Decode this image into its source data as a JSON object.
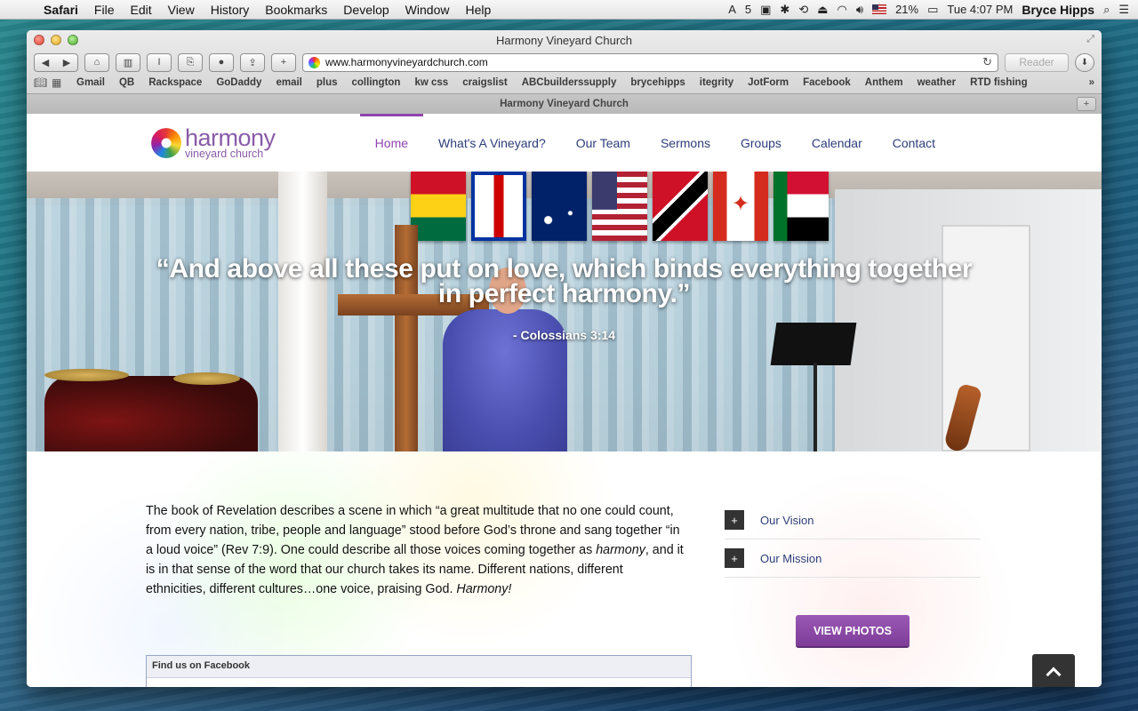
{
  "menubar": {
    "app": "Safari",
    "items": [
      "File",
      "Edit",
      "View",
      "History",
      "Bookmarks",
      "Develop",
      "Window",
      "Help"
    ],
    "adobe_count": "5",
    "battery": "21%",
    "clock": "Tue 4:07 PM",
    "user": "Bryce Hipps"
  },
  "window": {
    "title": "Harmony Vineyard Church",
    "url": "www.harmonyvineyardchurch.com",
    "reader_label": "Reader",
    "tab_title": "Harmony Vineyard Church"
  },
  "bookmarks": [
    "Gmail",
    "QB",
    "Rackspace",
    "GoDaddy",
    "email",
    "plus",
    "collington",
    "kw css",
    "craigslist",
    "ABCbuilderssupply",
    "brycehipps",
    "itegrity",
    "JotForm",
    "Facebook",
    "Anthem",
    "weather",
    "RTD fishing"
  ],
  "site": {
    "logo_name": "harmony",
    "logo_sub": "vineyard church",
    "nav": [
      "Home",
      "What's A Vineyard?",
      "Our Team",
      "Sermons",
      "Groups",
      "Calendar",
      "Contact"
    ],
    "active_nav": "Home",
    "hero_quote": "“And above all these put on love, which binds everything together in perfect harmony.”",
    "hero_cite": "- Colossians 3:14",
    "intro_parts": [
      " The book of Revelation describes a scene in which “a great multitude that no one could count, from every nation, tribe, people and language” stood before God’s throne and sang together “in a loud voice” (Rev 7:9).  One could describe all those voices coming together as ",
      "harmony",
      ", and it is in that sense of the word that our church takes its name.  Different nations, different ethnicities, different cultures…one voice, praising God.  ",
      "Harmony!"
    ],
    "accordion": [
      "Our Vision",
      "Our Mission"
    ],
    "view_photos": "VIEW PHOTOS",
    "facebook_title": "Find us on Facebook"
  },
  "colors": {
    "accent": "#8e44ad",
    "nav_link": "#2c3e7a"
  }
}
